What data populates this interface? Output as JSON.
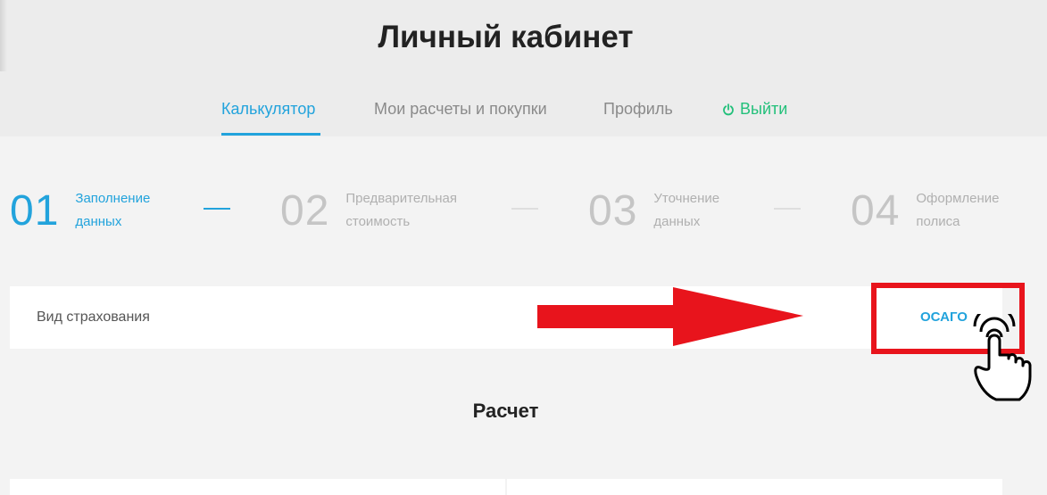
{
  "header": {
    "title": "Личный кабинет",
    "tabs": [
      {
        "label": "Калькулятор",
        "active": true
      },
      {
        "label": "Мои расчеты и покупки",
        "active": false
      },
      {
        "label": "Профиль",
        "active": false
      },
      {
        "label": "Выйти",
        "active": false,
        "icon": "power-icon"
      }
    ]
  },
  "steps": [
    {
      "number": "01",
      "label_line1": "Заполнение",
      "label_line2": "данных",
      "active": true
    },
    {
      "number": "02",
      "label_line1": "Предварительная",
      "label_line2": "стоимость",
      "active": false
    },
    {
      "number": "03",
      "label_line1": "Уточнение",
      "label_line2": "данных",
      "active": false
    },
    {
      "number": "04",
      "label_line1": "Оформление",
      "label_line2": "полиса",
      "active": false
    }
  ],
  "insurance": {
    "label": "Вид страхования",
    "value": "ОСАГО"
  },
  "calculation": {
    "title": "Расчет"
  },
  "colors": {
    "accent": "#22a3dc",
    "logout": "#22c07a",
    "annotation": "#e8141c"
  }
}
